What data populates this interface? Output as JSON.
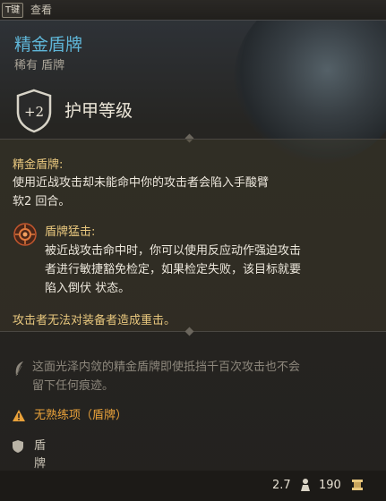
{
  "topbar": {
    "key": "T键",
    "action": "查看"
  },
  "item": {
    "name": "精金盾牌",
    "rarity_type": "稀有 盾牌",
    "armor_bonus": "+2",
    "armor_label": "护甲等级"
  },
  "passive": {
    "title": "精金盾牌:",
    "desc_line1": "使用近战攻击却未能命中你的攻击者会陷入手酸臂",
    "desc_line2": "软2 回合。"
  },
  "ability": {
    "title": "盾牌猛击:",
    "line1": "被近战攻击命中时，你可以使用反应动作强迫攻击",
    "line2": "者进行敏捷豁免检定，如果检定失败，该目标就要",
    "line3": "陷入倒伏 状态。"
  },
  "crit_immunity": "攻击者无法对装备者造成重击。",
  "flavor": {
    "line1": "这面光泽内敛的精金盾牌即使抵挡千百次攻击也不会",
    "line2": "留下任何痕迹。"
  },
  "proficiency": "无熟练项（盾牌）",
  "item_type": "盾牌",
  "footer": {
    "weight": "2.7",
    "price": "190"
  },
  "colors": {
    "title": "#5fb6d8",
    "gold": "#e8c77e",
    "warning": "#e8a13a"
  },
  "icons": [
    "armor-shield-icon",
    "shield-bash-icon",
    "feather-icon",
    "warning-icon",
    "shield-type-icon",
    "weight-icon",
    "gold-coin-icon"
  ]
}
